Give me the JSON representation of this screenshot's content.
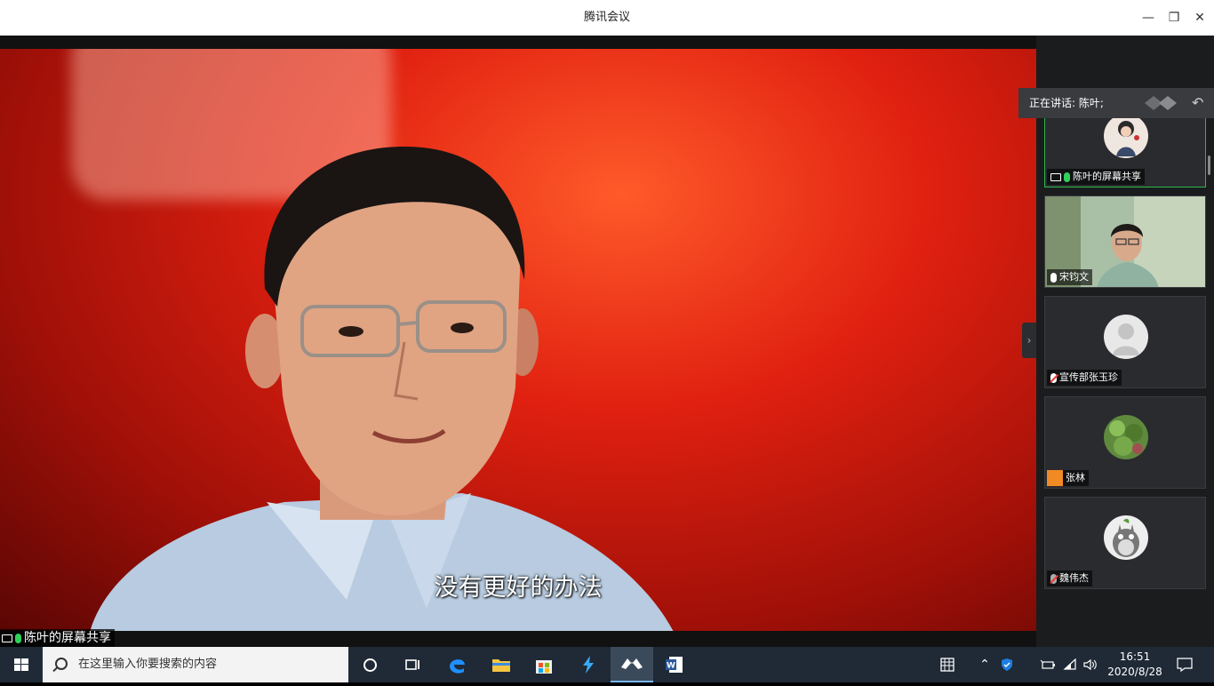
{
  "window": {
    "title": "腾讯会议",
    "minimize": "—",
    "restore": "❐",
    "close": "✕"
  },
  "video": {
    "subtitle": "没有更好的办法",
    "share_label": "陈叶的屏幕共享"
  },
  "sidebar": {
    "speaking_text": "正在讲话: 陈叶;",
    "collapse_glyph": "›",
    "back_glyph": "↶",
    "participants": [
      {
        "name": "陈叶的屏幕共享",
        "mic": "on",
        "avatar": "woman-illustration-icon"
      },
      {
        "name": "宋钧文",
        "mic": "on-white",
        "avatar": "camera-video"
      },
      {
        "name": "宣传部张玉珍",
        "mic": "muted",
        "avatar": "default-person-icon"
      },
      {
        "name": "张林",
        "mic": "none",
        "avatar": "plant-icon"
      },
      {
        "name": "魏伟杰",
        "mic": "muted",
        "avatar": "totoro-icon"
      }
    ]
  },
  "taskbar": {
    "search_placeholder": "在这里输入你要搜索的内容",
    "time": "16:51",
    "date": "2020/8/28",
    "apps": [
      "cortana-icon",
      "task-view-icon",
      "edge-icon",
      "file-explorer-icon",
      "store-icon",
      "tool-icon",
      "tencent-meeting-icon",
      "word-icon"
    ]
  }
}
